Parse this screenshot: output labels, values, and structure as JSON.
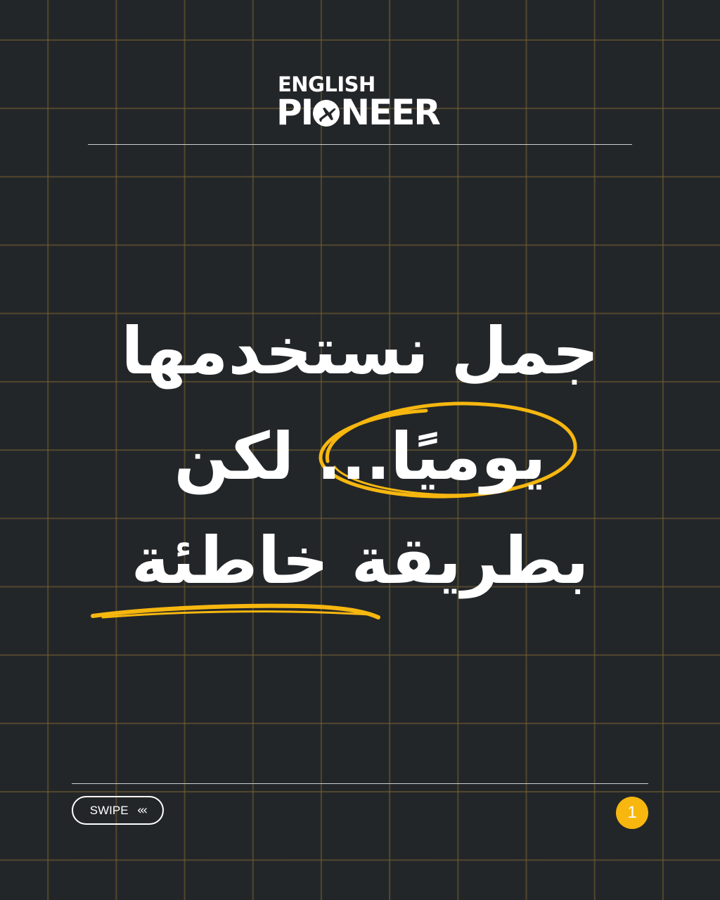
{
  "logo": {
    "line1": "ENGLISH",
    "line2_part1": "PI",
    "line2_part2": "NEER"
  },
  "headline": {
    "line1": "جمل نستخدمها",
    "line2": "يوميًا... لكن",
    "line3": "بطريقة خاطئة"
  },
  "footer": {
    "swipe_label": "SWIPE",
    "swipe_arrows": "‹‹‹",
    "page_number": "1"
  },
  "colors": {
    "background": "#232629",
    "accent": "#f7b70f",
    "grid": "#786230",
    "text": "#ffffff"
  }
}
